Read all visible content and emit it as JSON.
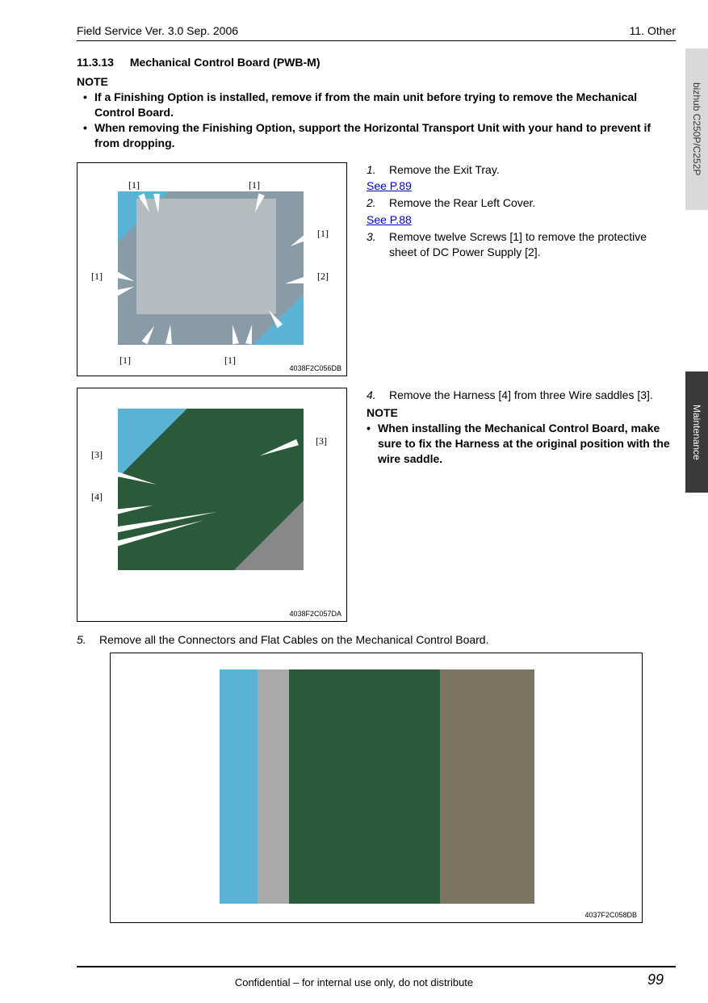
{
  "header": {
    "left": "Field Service Ver. 3.0 Sep. 2006",
    "right": "11. Other"
  },
  "section": {
    "number": "11.3.13",
    "title": "Mechanical Control Board (PWB-M)"
  },
  "note_label": "NOTE",
  "notes": [
    "If a Finishing Option is installed, remove if from the main unit before trying to remove the Mechanical Control Board.",
    "When removing the Finishing Option, support the Horizontal Transport Unit with your hand to prevent if from dropping."
  ],
  "figures": {
    "f1": {
      "id": "4038F2C056DB",
      "labels": [
        "[1]",
        "[1]",
        "[1]",
        "[1]",
        "[1]",
        "[1]",
        "[2]"
      ]
    },
    "f2": {
      "id": "4038F2C057DA",
      "labels": [
        "[3]",
        "[3]",
        "[4]"
      ]
    },
    "f3": {
      "id": "4037F2C058DB"
    }
  },
  "steps_block1": {
    "s1_num": "1.",
    "s1_text": "Remove the Exit Tray.",
    "s1_link": "See P.89",
    "s2_num": "2.",
    "s2_text": "Remove the Rear Left Cover.",
    "s2_link": "See P.88",
    "s3_num": "3.",
    "s3_text": "Remove twelve Screws [1] to remove the protective sheet of DC Power Supply [2]."
  },
  "steps_block2": {
    "s4_num": "4.",
    "s4_text": "Remove the Harness [4] from three Wire saddles [3].",
    "note_label": "NOTE",
    "note_text": "When installing the Mechanical Control Board, make sure to fix the Harness at the original position with the wire saddle."
  },
  "step5": {
    "num": "5.",
    "text": "Remove all the Connectors and Flat Cables on the Mechanical Control Board."
  },
  "footer": "Confidential – for internal use only, do not distribute",
  "page_number": "99",
  "side_tabs": {
    "tab1": "bizhub C250P/C252P",
    "tab2": "Maintenance"
  }
}
